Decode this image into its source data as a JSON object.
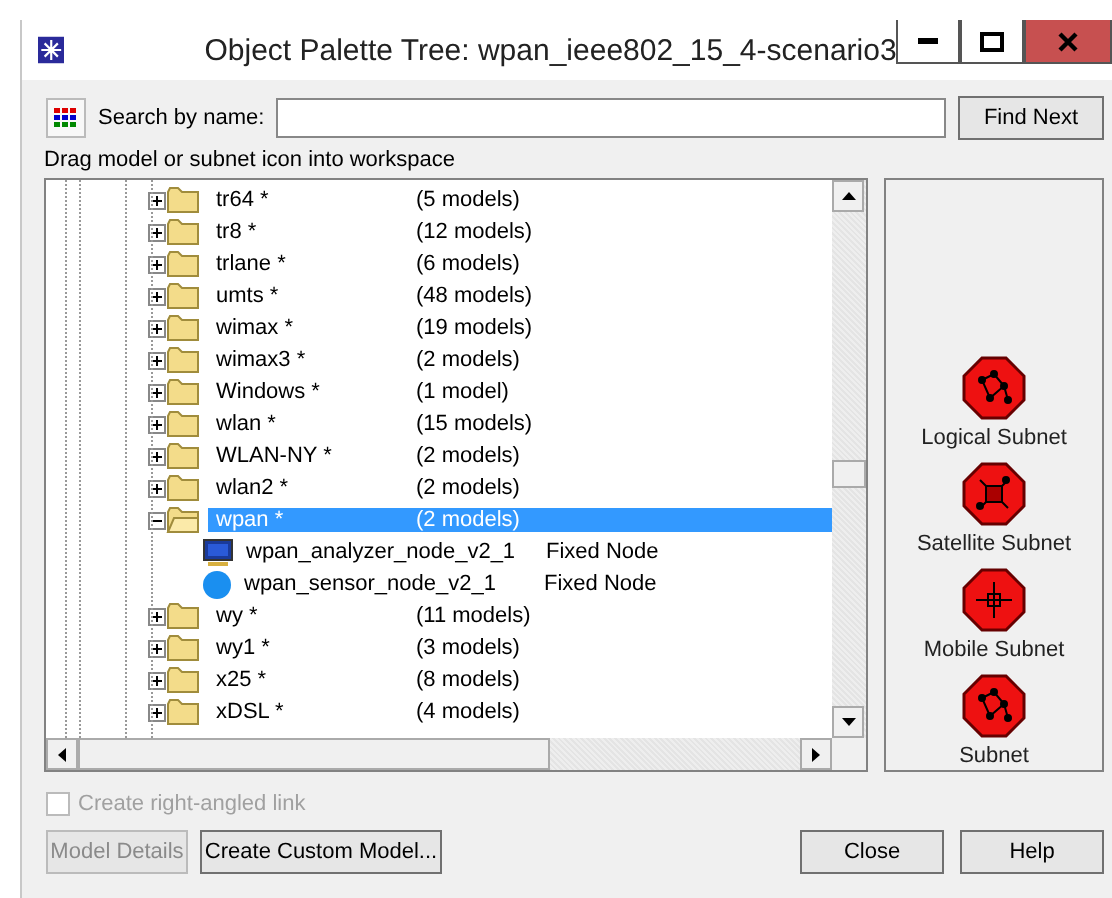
{
  "window": {
    "title": "Object Palette Tree: wpan_ieee802_15_4-scenario3"
  },
  "search": {
    "label": "Search by name:",
    "button": "Find Next"
  },
  "hint": "Drag model or subnet icon into workspace",
  "tree": [
    {
      "label": "tr64 *",
      "count": "(5 models)",
      "expanded": false,
      "selected": false
    },
    {
      "label": "tr8 *",
      "count": "(12 models)",
      "expanded": false,
      "selected": false
    },
    {
      "label": "trlane *",
      "count": "(6 models)",
      "expanded": false,
      "selected": false
    },
    {
      "label": "umts *",
      "count": "(48 models)",
      "expanded": false,
      "selected": false
    },
    {
      "label": "wimax *",
      "count": "(19 models)",
      "expanded": false,
      "selected": false
    },
    {
      "label": "wimax3 *",
      "count": "(2 models)",
      "expanded": false,
      "selected": false
    },
    {
      "label": "Windows *",
      "count": "(1 model)",
      "expanded": false,
      "selected": false
    },
    {
      "label": "wlan *",
      "count": "(15 models)",
      "expanded": false,
      "selected": false
    },
    {
      "label": "WLAN-NY *",
      "count": "(2 models)",
      "expanded": false,
      "selected": false
    },
    {
      "label": "wlan2 *",
      "count": "(2 models)",
      "expanded": false,
      "selected": false
    },
    {
      "label": "wpan *",
      "count": "(2 models)",
      "expanded": true,
      "selected": true,
      "children": [
        {
          "label": "wpan_analyzer_node_v2_1",
          "type": "Fixed Node",
          "kind": "monitor"
        },
        {
          "label": "wpan_sensor_node_v2_1",
          "type": "Fixed Node",
          "kind": "sphere"
        }
      ]
    },
    {
      "label": "wy *",
      "count": "(11 models)",
      "expanded": false,
      "selected": false
    },
    {
      "label": "wy1 *",
      "count": "(3 models)",
      "expanded": false,
      "selected": false
    },
    {
      "label": "x25 *",
      "count": "(8 models)",
      "expanded": false,
      "selected": false
    },
    {
      "label": "xDSL *",
      "count": "(4 models)",
      "expanded": false,
      "selected": false
    }
  ],
  "subnets": [
    {
      "label": "Logical Subnet",
      "kind": "logical"
    },
    {
      "label": "Satellite Subnet",
      "kind": "satellite"
    },
    {
      "label": "Mobile Subnet",
      "kind": "mobile"
    },
    {
      "label": "Subnet",
      "kind": "logical"
    }
  ],
  "option": {
    "label": "Create right-angled link",
    "checked": false,
    "disabled": true
  },
  "buttons": [
    {
      "label": "Model Details",
      "disabled": true
    },
    {
      "label": "Create Custom Model...",
      "disabled": false
    }
  ],
  "dialog_buttons": [
    "Close",
    "Help"
  ]
}
